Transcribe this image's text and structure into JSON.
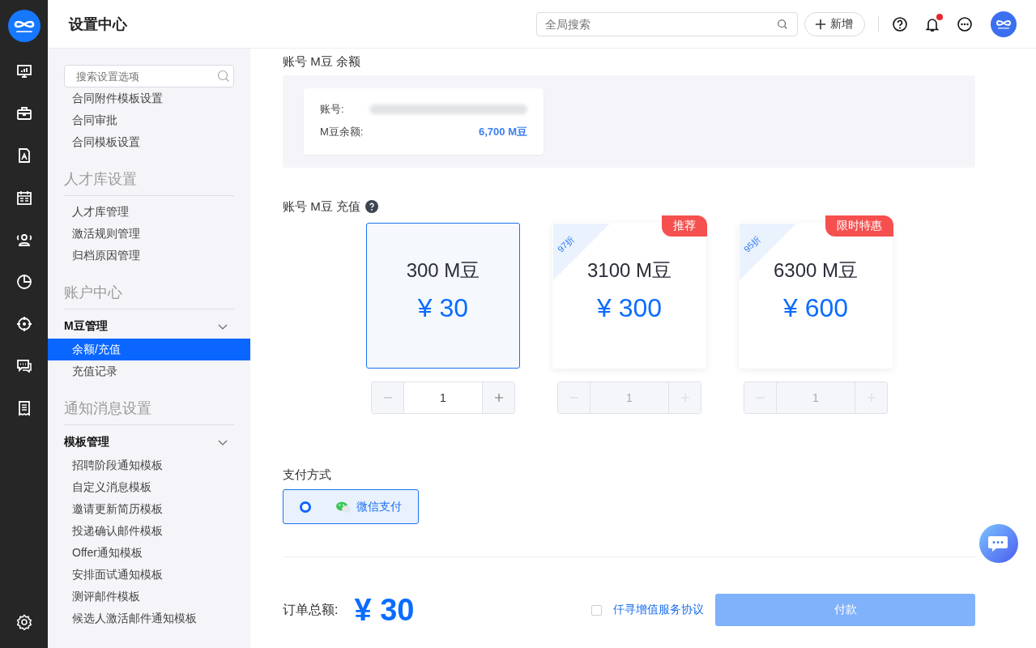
{
  "header": {
    "title": "设置中心",
    "search": {
      "placeholder": "全局搜索"
    },
    "new_button": "新增",
    "notifications": {
      "unread": true
    }
  },
  "sidebar": {
    "search": {
      "placeholder": "搜索设置选项"
    },
    "sections": [
      {
        "entries": [
          {
            "kind": "item",
            "label": "合同附件模板设置",
            "selected": false
          },
          {
            "kind": "item",
            "label": "合同审批",
            "selected": false
          },
          {
            "kind": "item",
            "label": "合同模板设置",
            "selected": false
          }
        ]
      },
      {
        "title": "人才库设置",
        "entries": [
          {
            "kind": "item",
            "label": "人才库管理",
            "selected": false
          },
          {
            "kind": "item",
            "label": "激活规则管理",
            "selected": false
          },
          {
            "kind": "item",
            "label": "归档原因管理",
            "selected": false
          }
        ]
      },
      {
        "title": "账户中心",
        "entries": [
          {
            "kind": "group",
            "label": "M豆管理",
            "expanded": true,
            "children": [
              {
                "label": "余额/充值",
                "selected": true
              },
              {
                "label": "充值记录",
                "selected": false
              }
            ]
          }
        ]
      },
      {
        "title": "通知消息设置",
        "entries": [
          {
            "kind": "group",
            "label": "模板管理",
            "expanded": true,
            "children": [
              {
                "label": "招聘阶段通知模板",
                "selected": false
              },
              {
                "label": "自定义消息模板",
                "selected": false
              },
              {
                "label": "邀请更新简历模板",
                "selected": false
              },
              {
                "label": "投递确认邮件模板",
                "selected": false
              },
              {
                "label": "Offer通知模板",
                "selected": false
              },
              {
                "label": "安排面试通知模板",
                "selected": false
              },
              {
                "label": "测评邮件模板",
                "selected": false
              },
              {
                "label": "候选人激活邮件通知模板",
                "selected": false
              }
            ]
          }
        ]
      }
    ]
  },
  "balance": {
    "title": "账号 M豆 余额",
    "account_label": "账号:",
    "balance_label": "M豆余额:",
    "balance": "6,700 M豆"
  },
  "recharge": {
    "title": "账号 M豆 充值",
    "packages": [
      {
        "beans": "300 M豆",
        "price": "¥ 30",
        "selected": true,
        "quantity": "1"
      },
      {
        "beans": "3100 M豆",
        "price": "¥ 300",
        "selected": false,
        "quantity": "1",
        "discount": "97折",
        "badge": "推荐"
      },
      {
        "beans": "6300 M豆",
        "price": "¥ 600",
        "selected": false,
        "quantity": "1",
        "discount": "95折",
        "badge": "限时特惠"
      }
    ]
  },
  "payment": {
    "title": "支付方式",
    "options": [
      {
        "label": "微信支付",
        "selected": true
      }
    ]
  },
  "footer": {
    "total_label": "订单总额:",
    "total": "¥ 30",
    "agreement": {
      "label": "仟寻增值服务协议",
      "checked": false
    },
    "pay_button": {
      "label": "付款",
      "disabled": true
    }
  }
}
